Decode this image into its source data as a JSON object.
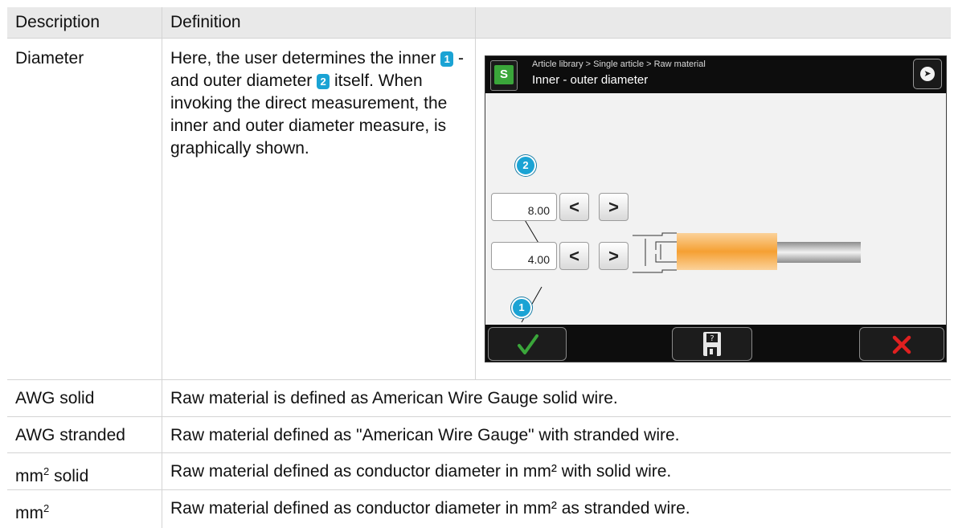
{
  "table": {
    "headers": [
      "Description",
      "Definition"
    ],
    "rows": [
      {
        "description": "Diameter",
        "definition_parts": [
          "Here, the user determines the inner ",
          "1",
          " - and outer diameter ",
          "2",
          " itself. When invoking the direct measurement, the inner and outer diameter measure, is graphically shown."
        ]
      },
      {
        "description": "AWG solid",
        "definition": "Raw material is defined as American Wire Gauge solid wire."
      },
      {
        "description": "AWG stranded",
        "definition": "Raw material defined as \"American Wire Gauge\" with stranded wire."
      },
      {
        "description_base": "mm",
        "description_sup": "2",
        "description_rest": " solid",
        "definition": "Raw material defined as conductor diameter in mm² with solid wire."
      },
      {
        "description_base": "mm",
        "description_sup": "2",
        "definition": "Raw material defined as conductor diameter in mm² as stranded wire."
      }
    ]
  },
  "screen": {
    "breadcrumb": "Article library > Single article > Raw material",
    "title": "Inner - outer diameter",
    "outer_value": "8.00",
    "inner_value": "4.00",
    "prev_label": "<",
    "next_label": ">",
    "marker_outer": "2",
    "marker_inner": "1",
    "logo_label": "S",
    "icons": [
      "next-arrow-icon",
      "confirm-check-icon",
      "save-disk-icon",
      "cancel-x-icon"
    ],
    "colors": {
      "accent": "#1aa3d4",
      "confirm": "#3aa63a",
      "cancel": "#e02020",
      "insulation": "#f5a033"
    }
  }
}
